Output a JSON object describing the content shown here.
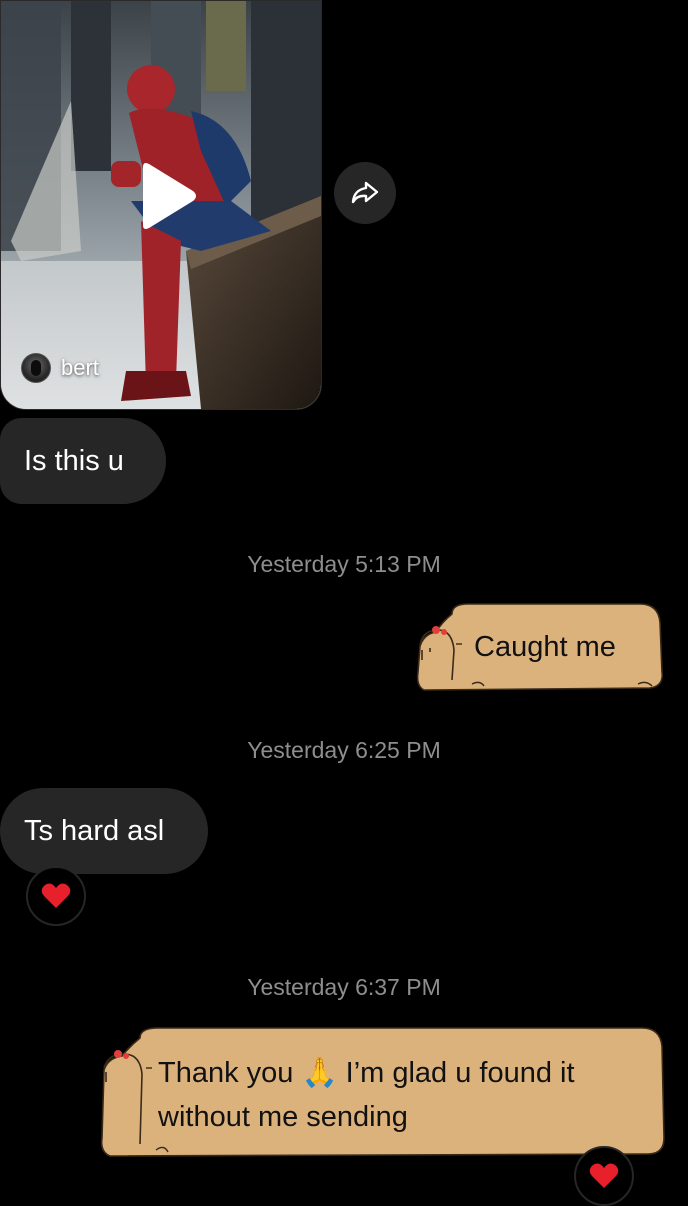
{
  "shared_post": {
    "author": "bert"
  },
  "messages": [
    {
      "direction": "received",
      "text": "Is this u"
    },
    {
      "timestamp": "Yesterday 5:13 PM"
    },
    {
      "direction": "sent",
      "text": "Caught me"
    },
    {
      "timestamp": "Yesterday 6:25 PM"
    },
    {
      "direction": "received",
      "text": "Ts hard asl",
      "reaction": "❤️"
    },
    {
      "timestamp": "Yesterday 6:37 PM"
    },
    {
      "direction": "sent",
      "text": "Thank you 🙏 I’m glad u found it without me sending",
      "reaction": "❤️"
    }
  ],
  "colors": {
    "background": "#000000",
    "received_bubble": "#262626",
    "sent_bubble": "#dcb27c",
    "timestamp": "#8e8e8e"
  }
}
